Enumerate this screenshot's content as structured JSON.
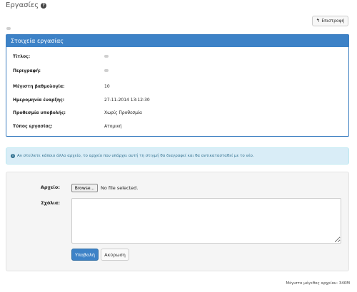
{
  "page": {
    "title": "Εργασίες"
  },
  "header": {
    "back_label": "Επιστροφή"
  },
  "details": {
    "heading": "Στοιχεία εργασίας",
    "rows": [
      {
        "label": "Τίτλος:",
        "value": ""
      },
      {
        "label": "Περιγραφή:",
        "value": ""
      },
      {
        "label": "Μέγιστη βαθμολογία:",
        "value": "10"
      },
      {
        "label": "Ημερομηνία έναρξης:",
        "value": "27-11-2014 13:12:30"
      },
      {
        "label": "Προθεσμία υποβολής:",
        "value": "Χωρίς Προθεσμία"
      },
      {
        "label": "Τύπος εργασίας:",
        "value": "Ατομική"
      }
    ]
  },
  "alert": {
    "text": "Αν στείλετε κάποιο άλλο αρχείο, το αρχείο που υπάρχει αυτή τη στιγμή θα διαγραφεί και θα αντικατασταθεί με το νέο."
  },
  "form": {
    "file_label": "Αρχείο:",
    "browse_label": "Browse...",
    "file_status": "No file selected.",
    "comments_label": "Σχόλια:",
    "comments_value": "",
    "submit_label": "Υποβολή",
    "cancel_label": "Ακύρωση"
  },
  "footer": {
    "max_size": "Μέγιστο μέγεθος αρχείου: 340M"
  }
}
